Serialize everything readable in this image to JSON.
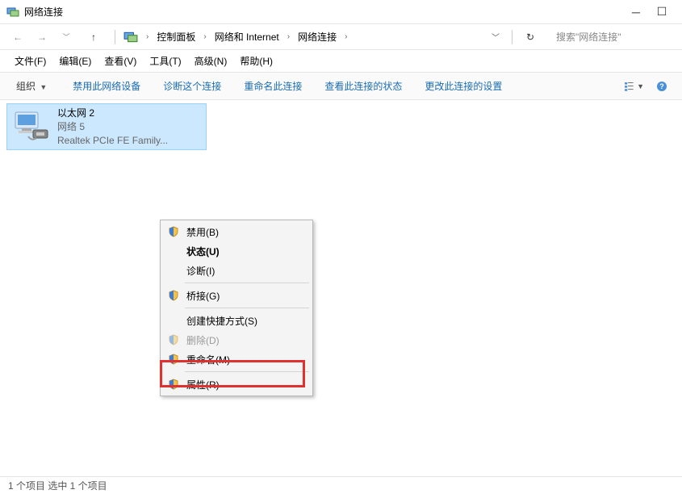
{
  "titlebar": {
    "title": "网络连接"
  },
  "breadcrumb": {
    "items": [
      "控制面板",
      "网络和 Internet",
      "网络连接"
    ]
  },
  "search": {
    "placeholder": "搜索\"网络连接\""
  },
  "menubar": [
    {
      "label": "文件(F)"
    },
    {
      "label": "编辑(E)"
    },
    {
      "label": "查看(V)"
    },
    {
      "label": "工具(T)"
    },
    {
      "label": "高级(N)"
    },
    {
      "label": "帮助(H)"
    }
  ],
  "toolbar": {
    "organize": "组织",
    "items": [
      "禁用此网络设备",
      "诊断这个连接",
      "重命名此连接",
      "查看此连接的状态",
      "更改此连接的设置"
    ]
  },
  "connection": {
    "name": "以太网 2",
    "status": "网络  5",
    "device": "Realtek PCIe FE Family..."
  },
  "context_menu": [
    {
      "label": "禁用(B)",
      "shield": true,
      "disabled": false
    },
    {
      "label": "状态(U)",
      "shield": false,
      "disabled": false,
      "bold": true
    },
    {
      "label": "诊断(I)",
      "shield": false,
      "disabled": false
    },
    {
      "sep": true
    },
    {
      "label": "桥接(G)",
      "shield": true,
      "disabled": false
    },
    {
      "sep": true
    },
    {
      "label": "创建快捷方式(S)",
      "shield": false,
      "disabled": false
    },
    {
      "label": "删除(D)",
      "shield": true,
      "disabled": true
    },
    {
      "label": "重命名(M)",
      "shield": true,
      "disabled": false
    },
    {
      "sep": true
    },
    {
      "label": "属性(R)",
      "shield": true,
      "disabled": false,
      "highlighted": true
    }
  ],
  "statusbar": {
    "text": "1 个项目    选中 1 个项目"
  }
}
